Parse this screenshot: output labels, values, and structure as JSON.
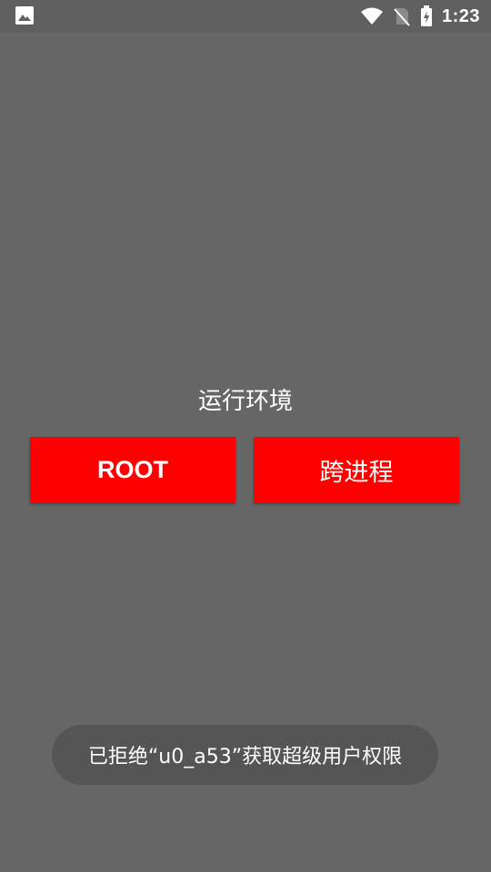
{
  "status_bar": {
    "time": "1:23",
    "icons": [
      "image-notification-icon",
      "wifi-icon",
      "no-sim-icon",
      "battery-charging-icon"
    ]
  },
  "main": {
    "section_title": "运行环境",
    "buttons": {
      "root_label": "ROOT",
      "cross_process_label": "跨进程"
    }
  },
  "toast": {
    "message": "已拒绝“u0_a53”获取超级用户权限"
  },
  "colors": {
    "background": "#666666",
    "status_bar": "#606060",
    "button": "#ff0000",
    "toast": "#555555",
    "text": "#ffffff"
  }
}
